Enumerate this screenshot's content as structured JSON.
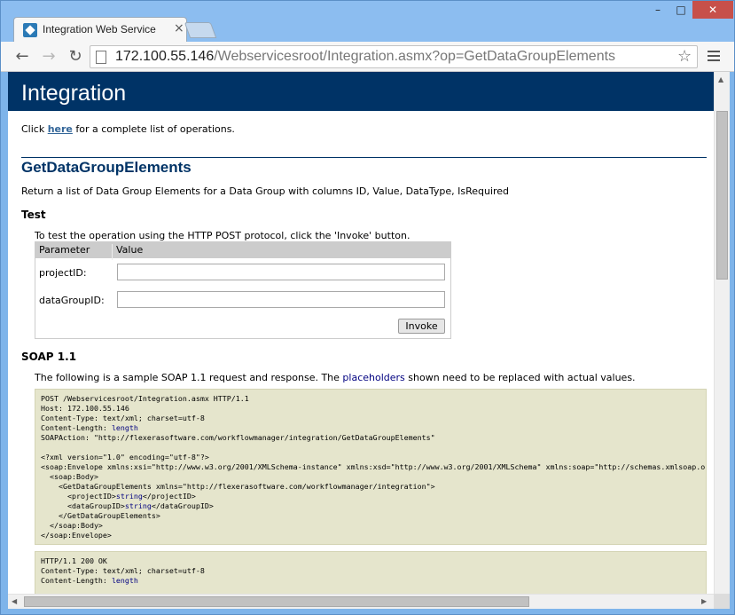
{
  "browser": {
    "tab_title": "Integration Web Service",
    "tab_close": "×",
    "window_minimize": "–",
    "window_maximize": "□",
    "window_close": "✕",
    "nav_back": "←",
    "nav_forward": "→",
    "nav_reload": "↻",
    "url_host": "172.100.55.146",
    "url_path": "/Webservicesroot/Integration.asmx?op=GetDataGroupElements",
    "star": "☆",
    "icons": [
      "favicon-icon",
      "page-icon",
      "star-icon",
      "menu-icon",
      "back-icon",
      "forward-icon",
      "reload-icon"
    ]
  },
  "page": {
    "title": "Integration",
    "intro_prefix": "Click ",
    "intro_link": "here",
    "intro_suffix": " for a complete list of operations.",
    "operation": {
      "name": "GetDataGroupElements",
      "description": "Return a list of Data Group Elements for a Data Group with columns ID, Value, DataType, IsRequired"
    },
    "test": {
      "heading": "Test",
      "intro": "To test the operation using the HTTP POST protocol, click the 'Invoke' button.",
      "col_parameter": "Parameter",
      "col_value": "Value",
      "params": [
        {
          "label": "projectID:",
          "value": ""
        },
        {
          "label": "dataGroupID:",
          "value": ""
        }
      ],
      "invoke_label": "Invoke"
    },
    "soap": {
      "heading": "SOAP 1.1",
      "intro_prefix": "The following is a sample SOAP 1.1 request and response. The ",
      "intro_placeholder": "placeholders",
      "intro_suffix": " shown need to be replaced with actual values.",
      "request": {
        "line1": "POST /Webservicesroot/Integration.asmx HTTP/1.1",
        "line2": "Host: 172.100.55.146",
        "line3": "Content-Type: text/xml; charset=utf-8",
        "line4_prefix": "Content-Length: ",
        "line4_ph": "length",
        "line5": "SOAPAction: \"http://flexerasoftware.com/workflowmanager/integration/GetDataGroupElements\"",
        "line7": "<?xml version=\"1.0\" encoding=\"utf-8\"?>",
        "line8": "<soap:Envelope xmlns:xsi=\"http://www.w3.org/2001/XMLSchema-instance\" xmlns:xsd=\"http://www.w3.org/2001/XMLSchema\" xmlns:soap=\"http://schemas.xmlsoap.org/soap/envelope/\">",
        "line9": "  <soap:Body>",
        "line10": "    <GetDataGroupElements xmlns=\"http://flexerasoftware.com/workflowmanager/integration\">",
        "line11_prefix": "      <projectID>",
        "line11_ph": "string",
        "line11_suffix": "</projectID>",
        "line12_prefix": "      <dataGroupID>",
        "line12_ph": "string",
        "line12_suffix": "</dataGroupID>",
        "line13": "    </GetDataGroupElements>",
        "line14": "  </soap:Body>",
        "line15": "</soap:Envelope>"
      },
      "response": {
        "line1": "HTTP/1.1 200 OK",
        "line2": "Content-Type: text/xml; charset=utf-8",
        "line3_prefix": "Content-Length: ",
        "line3_ph": "length"
      }
    }
  },
  "colors": {
    "header_band": "#003366",
    "heading_text": "#003366",
    "link": "#336699",
    "code_bg": "#e5e5cc",
    "placeholder": "#000080",
    "close_button": "#c7504a"
  }
}
